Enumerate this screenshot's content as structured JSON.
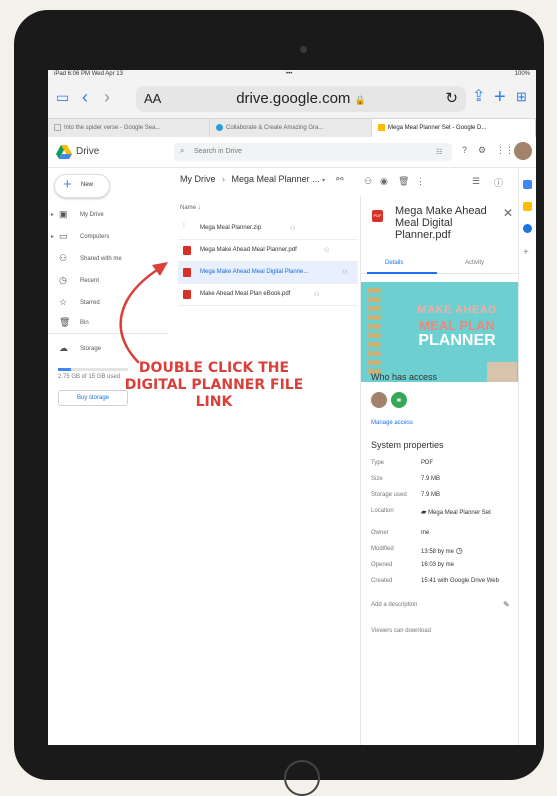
{
  "status_bar": {
    "left": "iPad  6:06 PM  Wed Apr 13",
    "center": "•••",
    "right": "100%"
  },
  "safari": {
    "text_size": "AA",
    "url": "drive.google.com",
    "lock": "🔒"
  },
  "tabs": [
    {
      "label": "Into the spider verse - Google Sea...",
      "active": false
    },
    {
      "label": "Collaborate & Create Amazing Gra...",
      "active": false
    },
    {
      "label": "Mega Meal Planner Set - Google D...",
      "active": true
    }
  ],
  "drive": {
    "title": "Drive",
    "search_placeholder": "Search in Drive"
  },
  "sidebar": {
    "new_label": "New",
    "items": [
      {
        "label": "My Drive",
        "icon": "my-drive-icon"
      },
      {
        "label": "Computers",
        "icon": "computers-icon"
      },
      {
        "label": "Shared with me",
        "icon": "shared-icon"
      },
      {
        "label": "Recent",
        "icon": "clock-icon"
      },
      {
        "label": "Starred",
        "icon": "star-icon"
      },
      {
        "label": "Bin",
        "icon": "trash-icon"
      }
    ],
    "storage_label": "Storage",
    "storage_used_text": "2.75 GB of 15 GB used",
    "storage_fraction": 0.18,
    "buy_storage": "Buy storage"
  },
  "main": {
    "breadcrumb_root": "My Drive",
    "breadcrumb_sep": "›",
    "breadcrumb_folder": "Mega Meal Planner ...",
    "name_header": "Name ↓",
    "files": [
      {
        "name": "Mega Meal Planner.zip",
        "type": "zip",
        "selected": false
      },
      {
        "name": "Mega Make Ahead Meal Planner.pdf",
        "type": "pdf",
        "selected": false
      },
      {
        "name": "Mega Make Ahead Meal Digital Planne...",
        "type": "pdf",
        "selected": true
      },
      {
        "name": "Make Ahead Meal Plan eBook.pdf",
        "type": "pdf",
        "selected": false
      }
    ]
  },
  "details": {
    "file_title": "Mega Make Ahead Meal Digital Planner.pdf",
    "pdf_badge": "PDF",
    "tab_details": "Details",
    "tab_activity": "Activity",
    "preview_line1": "MAKE AHEAD",
    "preview_line2": "MEAL PLAN",
    "preview_line3": "PLANNER",
    "who_has_access": "Who has access",
    "manage_access": "Manage access",
    "system_properties": "System properties",
    "properties": [
      {
        "key": "Type",
        "value": "PDF"
      },
      {
        "key": "Size",
        "value": "7.9 MB"
      },
      {
        "key": "Storage used",
        "value": "7.9 MB"
      },
      {
        "key": "Location",
        "value": "Mega Meal Planner Set"
      },
      {
        "key": "Owner",
        "value": "me"
      },
      {
        "key": "Modified",
        "value": "13:58 by me"
      },
      {
        "key": "Opened",
        "value": "16:03 by me"
      },
      {
        "key": "Created",
        "value": "15:41 with Google Drive Web"
      }
    ],
    "add_description": "Add a description",
    "viewers_download": "Viewers can download"
  },
  "annotation": {
    "text": "DOUBLE CLICK THE DIGITAL PLANNER FILE LINK",
    "color": "#d9403a"
  }
}
